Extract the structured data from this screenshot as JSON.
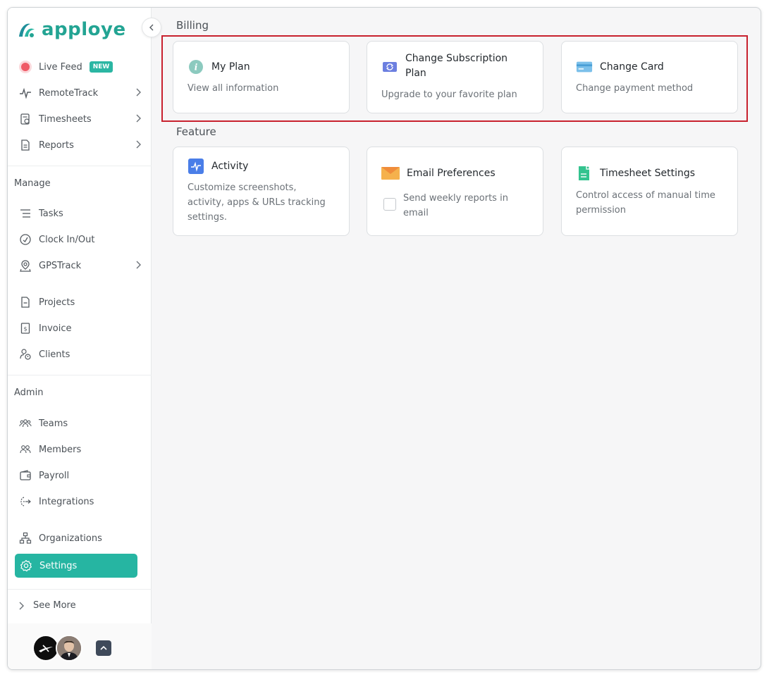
{
  "brand": {
    "name": "apploye",
    "color": "#23a493"
  },
  "sidebar": {
    "top_items": [
      {
        "label": "Live Feed",
        "badge": "NEW",
        "icon": "live-dot-icon"
      },
      {
        "label": "RemoteTrack",
        "icon": "pulse-icon"
      },
      {
        "label": "Timesheets",
        "icon": "timesheet-icon"
      },
      {
        "label": "Reports",
        "icon": "report-icon"
      }
    ],
    "manage_title": "Manage",
    "manage_items": [
      {
        "label": "Tasks",
        "icon": "tasks-icon"
      },
      {
        "label": "Clock In/Out",
        "icon": "clock-icon"
      },
      {
        "label": "GPSTrack",
        "icon": "location-icon"
      },
      {
        "label": "Projects",
        "icon": "project-icon"
      },
      {
        "label": "Invoice",
        "icon": "invoice-icon"
      },
      {
        "label": "Clients",
        "icon": "clients-icon"
      }
    ],
    "admin_title": "Admin",
    "admin_items": [
      {
        "label": "Teams",
        "icon": "teams-icon"
      },
      {
        "label": "Members",
        "icon": "members-icon"
      },
      {
        "label": "Payroll",
        "icon": "wallet-icon"
      },
      {
        "label": "Integrations",
        "icon": "integrations-icon"
      },
      {
        "label": "Organizations",
        "icon": "org-icon"
      }
    ],
    "active_item": {
      "label": "Settings",
      "icon": "gear-icon",
      "color": "#26b5a2"
    },
    "see_more": "See More"
  },
  "main": {
    "billing_title": "Billing",
    "billing_cards": [
      {
        "title": "My Plan",
        "desc": "View all information",
        "icon": "info-icon"
      },
      {
        "title": "Change Subscription Plan",
        "desc": "Upgrade to your favorite plan",
        "icon": "refresh-icon"
      },
      {
        "title": "Change Card",
        "desc": "Change payment method",
        "icon": "credit-card-icon"
      }
    ],
    "feature_title": "Feature",
    "feature_cards": [
      {
        "title": "Activity",
        "desc": "Customize screenshots, activity, apps & URLs tracking settings.",
        "icon": "activity-icon"
      },
      {
        "title": "Email Preferences",
        "desc": "Send weekly reports in email",
        "icon": "envelope-icon"
      },
      {
        "title": "Timesheet Settings",
        "desc": "Control access of manual time permission",
        "icon": "timesheet-settings-icon"
      }
    ],
    "highlight_color": "#c8212e"
  }
}
